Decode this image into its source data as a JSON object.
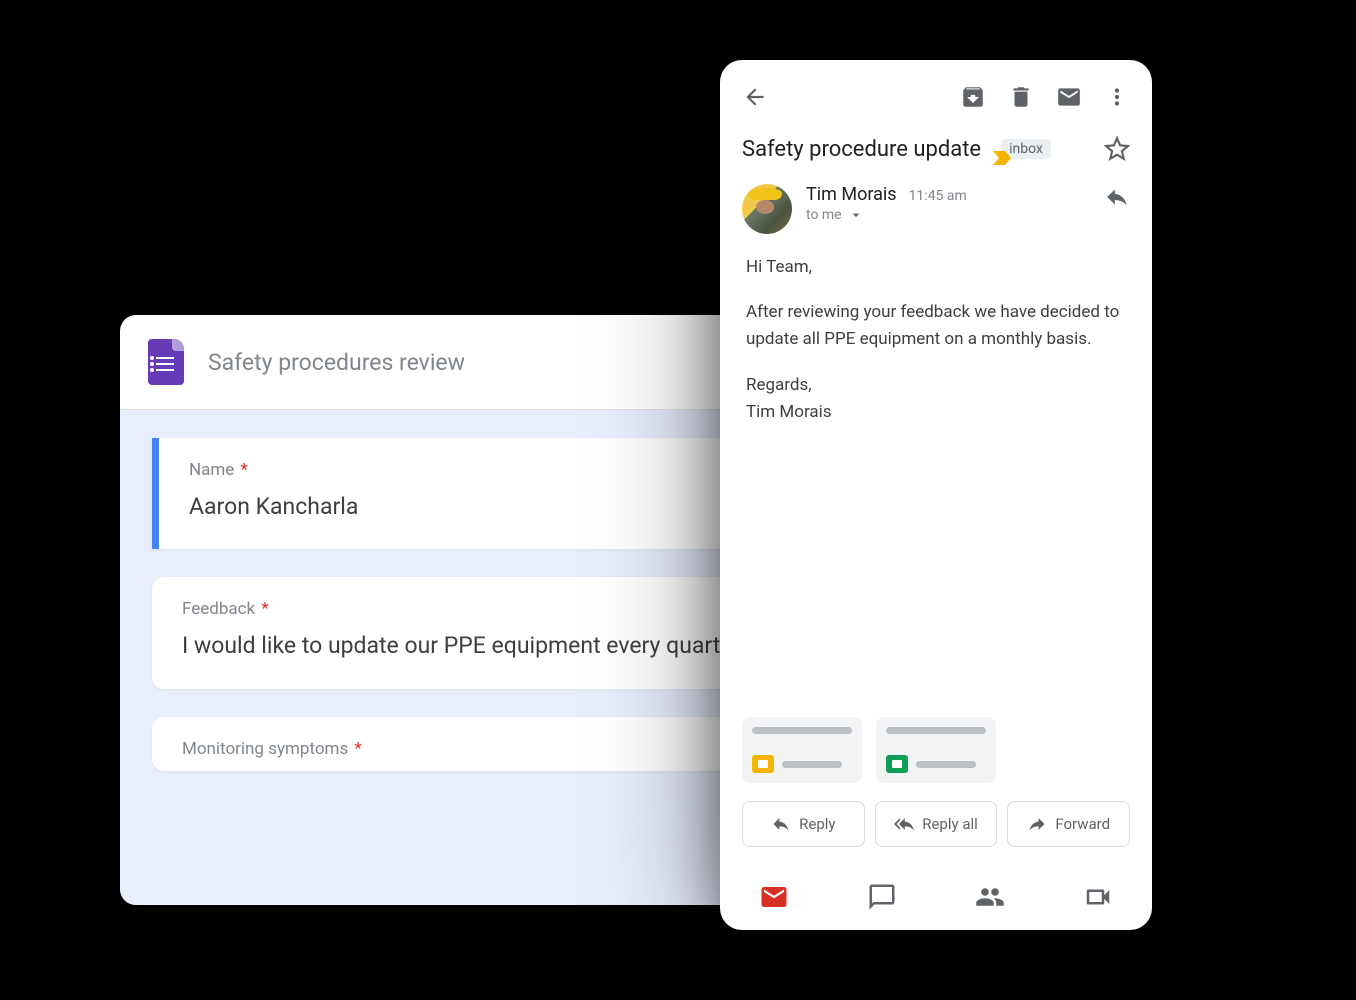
{
  "forms": {
    "title": "Safety procedures review",
    "fields": {
      "name": {
        "label": "Name",
        "value": "Aaron Kancharla",
        "required": "*"
      },
      "feedback": {
        "label": "Feedback",
        "value": "I would like to update our PPE equipment every quarter.",
        "required": "*"
      },
      "monitoring": {
        "label": "Monitoring symptoms",
        "required": "*"
      }
    }
  },
  "gmail": {
    "subject": "Safety procedure update",
    "label_chip": "inbox",
    "sender": {
      "name": "Tim Morais",
      "time": "11:45 am",
      "to": "to me"
    },
    "body": {
      "greeting": "Hi Team,",
      "para1": "After reviewing your feedback we have decided to update all PPE equipment on a monthly basis.",
      "signoff1": "Regards,",
      "signoff2": "Tim Morais"
    },
    "actions": {
      "reply": "Reply",
      "reply_all": "Reply all",
      "forward": "Forward"
    }
  }
}
